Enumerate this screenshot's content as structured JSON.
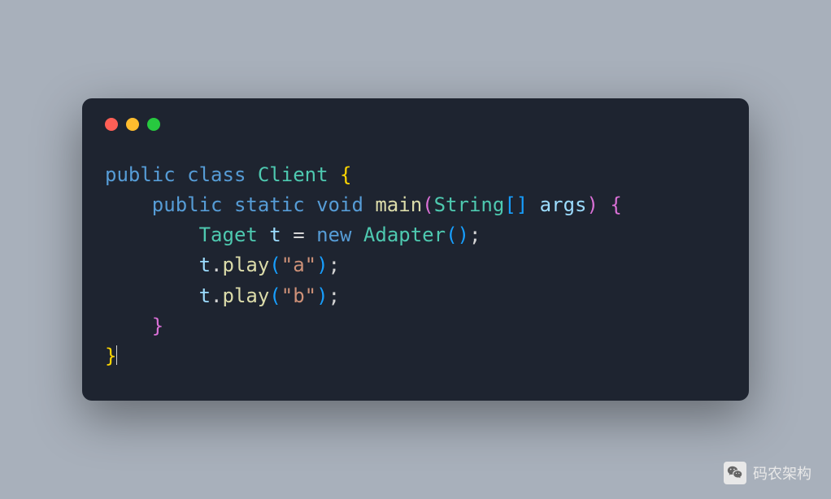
{
  "code": {
    "line1": {
      "kw1": "public",
      "kw2": "class",
      "cls": "Client",
      "open": "{"
    },
    "line2": {
      "indent": "    ",
      "kw1": "public",
      "kw2": "static",
      "kw3": "void",
      "method": "main",
      "parenOpen": "(",
      "type": "String",
      "brOpen": "[",
      "brClose": "]",
      "param": "args",
      "parenClose": ")",
      "braceOpen": "{"
    },
    "line3": {
      "indent": "        ",
      "type": "Taget",
      "var": "t",
      "eq": "=",
      "kw": "new",
      "cls": "Adapter",
      "parenOpen": "(",
      "parenClose": ")",
      "semi": ";"
    },
    "line4": {
      "indent": "        ",
      "var": "t",
      "dot": ".",
      "method": "play",
      "parenOpen": "(",
      "str": "\"a\"",
      "parenClose": ")",
      "semi": ";"
    },
    "line5": {
      "indent": "        ",
      "var": "t",
      "dot": ".",
      "method": "play",
      "parenOpen": "(",
      "str": "\"b\"",
      "parenClose": ")",
      "semi": ";"
    },
    "line6": {
      "indent": "    ",
      "close": "}"
    },
    "line7": {
      "close": "}"
    }
  },
  "watermark": {
    "text": "码农架构"
  }
}
